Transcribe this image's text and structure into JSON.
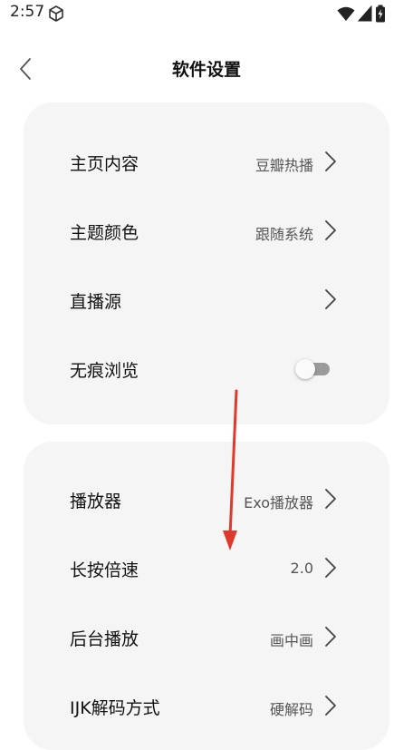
{
  "status_bar": {
    "time": "2:57",
    "icons": [
      "cube-icon",
      "wifi-icon",
      "cellular-signal-icon",
      "battery-charging-icon"
    ]
  },
  "header": {
    "title": "软件设置",
    "back_icon": "chevron-left-icon"
  },
  "sections": [
    {
      "rows": [
        {
          "label": "主页内容",
          "value": "豆瓣热播",
          "control": "chevron"
        },
        {
          "label": "主题颜色",
          "value": "跟随系统",
          "control": "chevron"
        },
        {
          "label": "直播源",
          "value": "",
          "control": "chevron"
        },
        {
          "label": "无痕浏览",
          "control": "toggle",
          "toggle_on": false
        }
      ]
    },
    {
      "rows": [
        {
          "label": "播放器",
          "value": "Exo播放器",
          "control": "chevron"
        },
        {
          "label": "长按倍速",
          "value": "2.0",
          "control": "chevron"
        },
        {
          "label": "后台播放",
          "value": "画中画",
          "control": "chevron"
        },
        {
          "label": "IJK解码方式",
          "value": "硬解码",
          "control": "chevron"
        }
      ]
    }
  ],
  "colors": {
    "card_background": "#f5f5f5",
    "annotation_arrow": "#e0392b",
    "toggle_off_track": "#9b9b9b"
  },
  "annotation": {
    "type": "arrow",
    "direction": "down"
  }
}
